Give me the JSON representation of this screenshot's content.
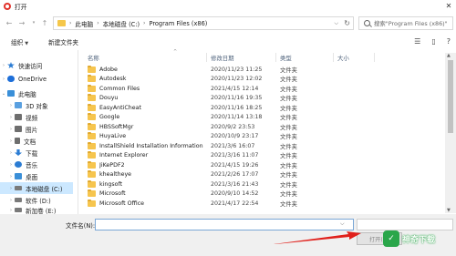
{
  "window": {
    "title": "打开"
  },
  "nav": {
    "breadcrumb": [
      "此电脑",
      "本地磁盘 (C:)",
      "Program Files (x86)"
    ],
    "search_placeholder": "搜索\"Program Files (x86)\""
  },
  "toolbar": {
    "organize_label": "组织",
    "new_folder_label": "新建文件夹"
  },
  "sidebar": {
    "items": [
      {
        "label": "快速访问",
        "icon": "star-icon",
        "color": "#2b7cd3"
      },
      {
        "label": "OneDrive",
        "icon": "cloud-icon",
        "color": "#1e6fd9"
      },
      {
        "label": "此电脑",
        "icon": "computer-icon",
        "color": "#3a8fd8"
      },
      {
        "label": "3D 对象",
        "icon": "cube-icon",
        "color": "#5aa0e0"
      },
      {
        "label": "视频",
        "icon": "video-icon",
        "color": "#6e6e6e"
      },
      {
        "label": "图片",
        "icon": "picture-icon",
        "color": "#6e6e6e"
      },
      {
        "label": "文档",
        "icon": "document-icon",
        "color": "#6e6e6e"
      },
      {
        "label": "下载",
        "icon": "download-icon",
        "color": "#2b7cd3"
      },
      {
        "label": "音乐",
        "icon": "music-icon",
        "color": "#2b7cd3"
      },
      {
        "label": "桌面",
        "icon": "desktop-icon",
        "color": "#3a8fd8"
      },
      {
        "label": "本地磁盘 (C:)",
        "icon": "drive-icon",
        "color": "#7a7a7a",
        "selected": true
      },
      {
        "label": "软件 (D:)",
        "icon": "drive-icon",
        "color": "#7a7a7a"
      },
      {
        "label": "新加卷 (E:)",
        "icon": "drive-icon",
        "color": "#7a7a7a"
      }
    ]
  },
  "columns": {
    "name": "名称",
    "date": "修改日期",
    "type": "类型",
    "size": "大小"
  },
  "files": [
    {
      "name": "Adobe",
      "date": "2020/11/23 11:25",
      "type": "文件夹"
    },
    {
      "name": "Autodesk",
      "date": "2020/11/23 12:02",
      "type": "文件夹"
    },
    {
      "name": "Common Files",
      "date": "2021/4/15 12:14",
      "type": "文件夹"
    },
    {
      "name": "Douyu",
      "date": "2020/11/16 19:35",
      "type": "文件夹"
    },
    {
      "name": "EasyAntiCheat",
      "date": "2020/11/16 18:25",
      "type": "文件夹"
    },
    {
      "name": "Google",
      "date": "2020/11/14 13:18",
      "type": "文件夹"
    },
    {
      "name": "HBSSoftMgr",
      "date": "2020/9/2 23:53",
      "type": "文件夹"
    },
    {
      "name": "HuyaLive",
      "date": "2020/10/9 23:17",
      "type": "文件夹"
    },
    {
      "name": "InstallShield Installation Information",
      "date": "2021/3/6 16:07",
      "type": "文件夹"
    },
    {
      "name": "Internet Explorer",
      "date": "2021/3/16 11:07",
      "type": "文件夹"
    },
    {
      "name": "JiKePDF2",
      "date": "2021/4/15 19:26",
      "type": "文件夹"
    },
    {
      "name": "khealtheye",
      "date": "2021/2/26 17:07",
      "type": "文件夹"
    },
    {
      "name": "kingsoft",
      "date": "2021/3/16 21:43",
      "type": "文件夹"
    },
    {
      "name": "Microsoft",
      "date": "2020/9/10 14:52",
      "type": "文件夹"
    },
    {
      "name": "Microsoft Office",
      "date": "2021/4/17 22:54",
      "type": "文件夹"
    }
  ],
  "bottom": {
    "filename_label": "文件名(N):",
    "filename_value": "",
    "open_label": "打开(O)"
  },
  "watermark": {
    "text": "神奇下载"
  }
}
